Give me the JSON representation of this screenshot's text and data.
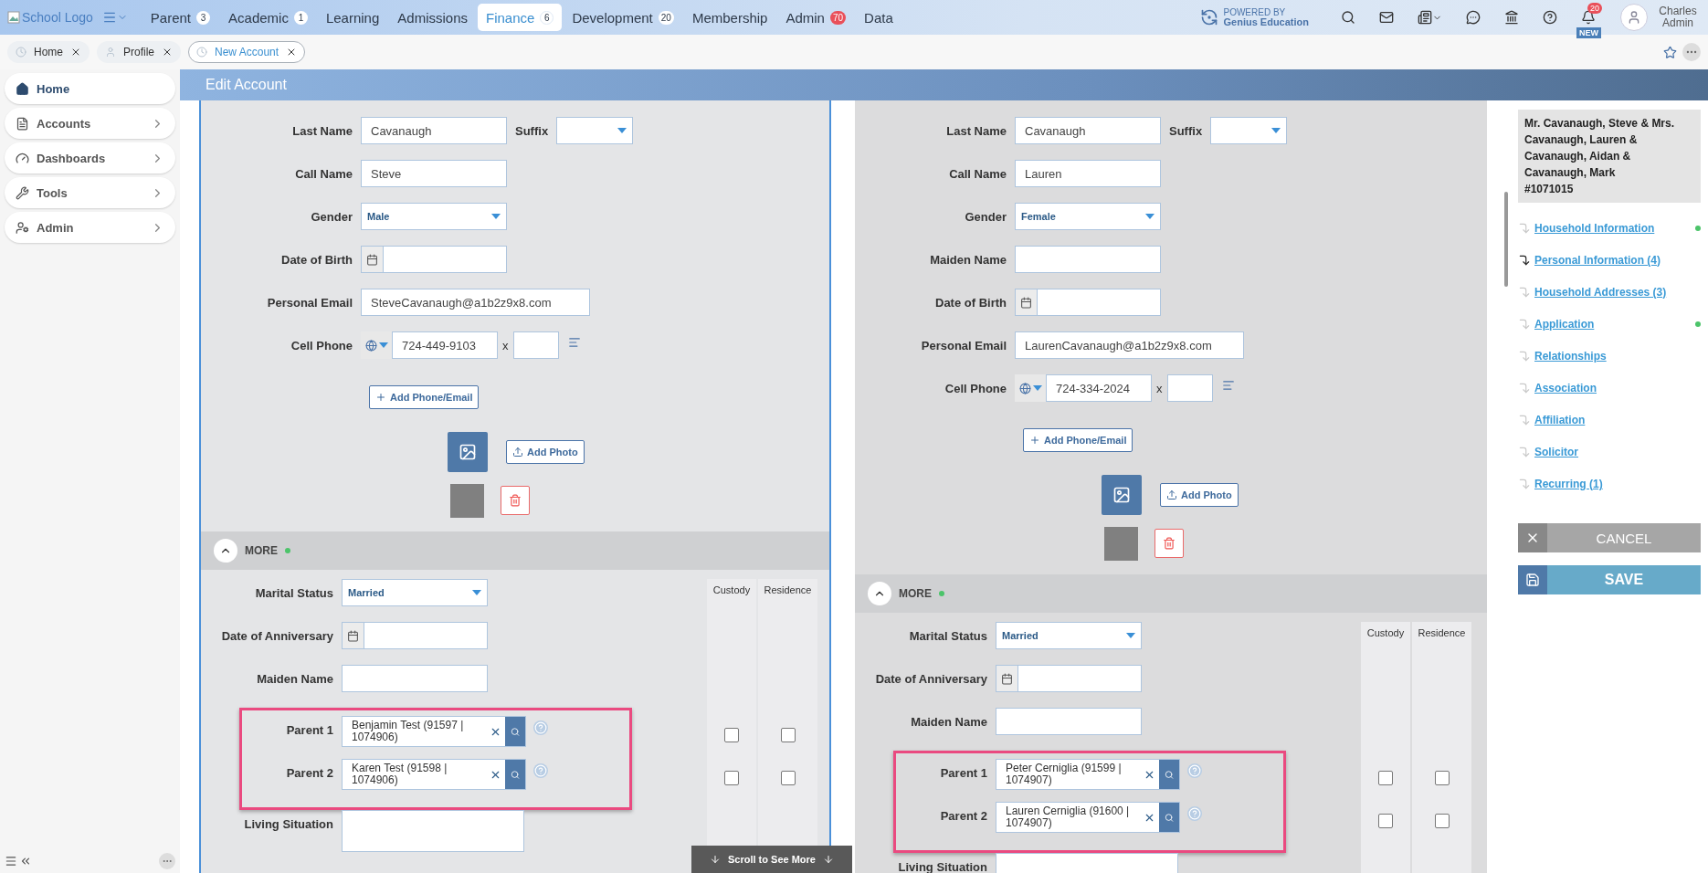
{
  "top_bar": {
    "logo": "School Logo",
    "menu": [
      {
        "label": "Parent",
        "badge": "3",
        "alert": false,
        "selected": false
      },
      {
        "label": "Academic",
        "badge": "1",
        "alert": false,
        "selected": false
      },
      {
        "label": "Learning",
        "selected": false
      },
      {
        "label": "Admissions",
        "selected": false
      },
      {
        "label": "Finance",
        "badge": "6",
        "alert": false,
        "selected": true
      },
      {
        "label": "Development",
        "badge": "20",
        "alert": false,
        "selected": false
      },
      {
        "label": "Membership",
        "selected": false
      },
      {
        "label": "Admin",
        "badge": "70",
        "alert": true,
        "selected": false
      },
      {
        "label": "Data",
        "selected": false
      }
    ],
    "powered_by": "POWERED BY",
    "brand": "Genius Education",
    "notifications": "20",
    "new_tag": "NEW",
    "user": "Charles Admin"
  },
  "open_tabs": [
    {
      "label": "Home",
      "selected": false
    },
    {
      "label": "Profile",
      "selected": false
    },
    {
      "label": "New Account",
      "selected": true
    }
  ],
  "sidebar": {
    "items": [
      {
        "label": "Home",
        "selected": true,
        "expandable": false
      },
      {
        "label": "Accounts",
        "selected": false,
        "expandable": true
      },
      {
        "label": "Dashboards",
        "selected": false,
        "expandable": true
      },
      {
        "label": "Tools",
        "selected": false,
        "expandable": true
      },
      {
        "label": "Admin",
        "selected": false,
        "expandable": true
      }
    ]
  },
  "header": {
    "title": "Edit Account"
  },
  "people": [
    {
      "fields": [
        {
          "kind": "text",
          "label": "Last Name",
          "value": "Cavanaugh",
          "suffix_label": "Suffix"
        },
        {
          "kind": "text",
          "label": "Call Name",
          "value": "Steve"
        },
        {
          "kind": "select",
          "label": "Gender",
          "value": "Male"
        },
        {
          "kind": "date",
          "label": "Date of Birth"
        },
        {
          "kind": "email",
          "label": "Personal Email",
          "value": "SteveCavanaugh@a1b2z9x8.com"
        },
        {
          "kind": "phone",
          "label": "Cell Phone",
          "value": "724-449-9103",
          "ext_label": "x"
        }
      ],
      "add_contact": "Add Phone/Email",
      "add_photo": "Add Photo",
      "more": {
        "title": "MORE",
        "flagged": true,
        "columns": [
          "Custody",
          "Residence"
        ],
        "fields": [
          {
            "kind": "select",
            "label": "Marital Status",
            "value": "Married"
          },
          {
            "kind": "date",
            "label": "Date of Anniversary"
          },
          {
            "kind": "text",
            "label": "Maiden Name"
          }
        ],
        "parents": [
          {
            "label": "Parent 1",
            "value": "Benjamin Test (91597 | 1074906)",
            "custody": false,
            "residence": false
          },
          {
            "label": "Parent 2",
            "value": "Karen Test (91598 | 1074906)",
            "custody": false,
            "residence": false
          }
        ],
        "after": [
          {
            "kind": "textarea",
            "label": "Living Situation"
          }
        ]
      }
    },
    {
      "fields": [
        {
          "kind": "text",
          "label": "Last Name",
          "value": "Cavanaugh",
          "suffix_label": "Suffix"
        },
        {
          "kind": "text",
          "label": "Call Name",
          "value": "Lauren"
        },
        {
          "kind": "select",
          "label": "Gender",
          "value": "Female"
        },
        {
          "kind": "text",
          "label": "Maiden Name"
        },
        {
          "kind": "date",
          "label": "Date of Birth"
        },
        {
          "kind": "email",
          "label": "Personal Email",
          "value": "LaurenCavanaugh@a1b2z9x8.com"
        },
        {
          "kind": "phone",
          "label": "Cell Phone",
          "value": "724-334-2024",
          "ext_label": "x"
        }
      ],
      "add_contact": "Add Phone/Email",
      "add_photo": "Add Photo",
      "more": {
        "title": "MORE",
        "flagged": true,
        "columns": [
          "Custody",
          "Residence"
        ],
        "fields": [
          {
            "kind": "select",
            "label": "Marital Status",
            "value": "Married"
          },
          {
            "kind": "date",
            "label": "Date of Anniversary"
          },
          {
            "kind": "text",
            "label": "Maiden Name"
          }
        ],
        "parents": [
          {
            "label": "Parent 1",
            "value": "Peter Cerniglia (91599 | 1074907)",
            "custody": false,
            "residence": false
          },
          {
            "label": "Parent 2",
            "value": "Lauren Cerniglia (91600 | 1074907)",
            "custody": false,
            "residence": false
          }
        ],
        "after": [
          {
            "kind": "textarea",
            "label": "Living Situation"
          }
        ]
      }
    }
  ],
  "outline": {
    "summary": "Mr. Cavanaugh, Steve & Mrs. Cavanaugh, Lauren & Cavanaugh, Aidan & Cavanaugh, Mark",
    "account_number": "#1071015",
    "sections": [
      {
        "label": "Household Information",
        "selected": false,
        "complete": true
      },
      {
        "label": "Personal Information (4)",
        "selected": true,
        "complete": false
      },
      {
        "label": "Household Addresses (3)",
        "selected": false,
        "complete": false
      },
      {
        "label": "Application",
        "selected": false,
        "complete": true
      },
      {
        "label": "Relationships",
        "selected": false,
        "complete": false
      },
      {
        "label": "Association",
        "selected": false,
        "complete": false
      },
      {
        "label": "Affiliation",
        "selected": false,
        "complete": false
      },
      {
        "label": "Solicitor",
        "selected": false,
        "complete": false
      },
      {
        "label": "Recurring (1)",
        "selected": false,
        "complete": false
      }
    ],
    "cancel": "CANCEL",
    "save": "SAVE"
  },
  "scroll_hint": "Scroll to See More"
}
